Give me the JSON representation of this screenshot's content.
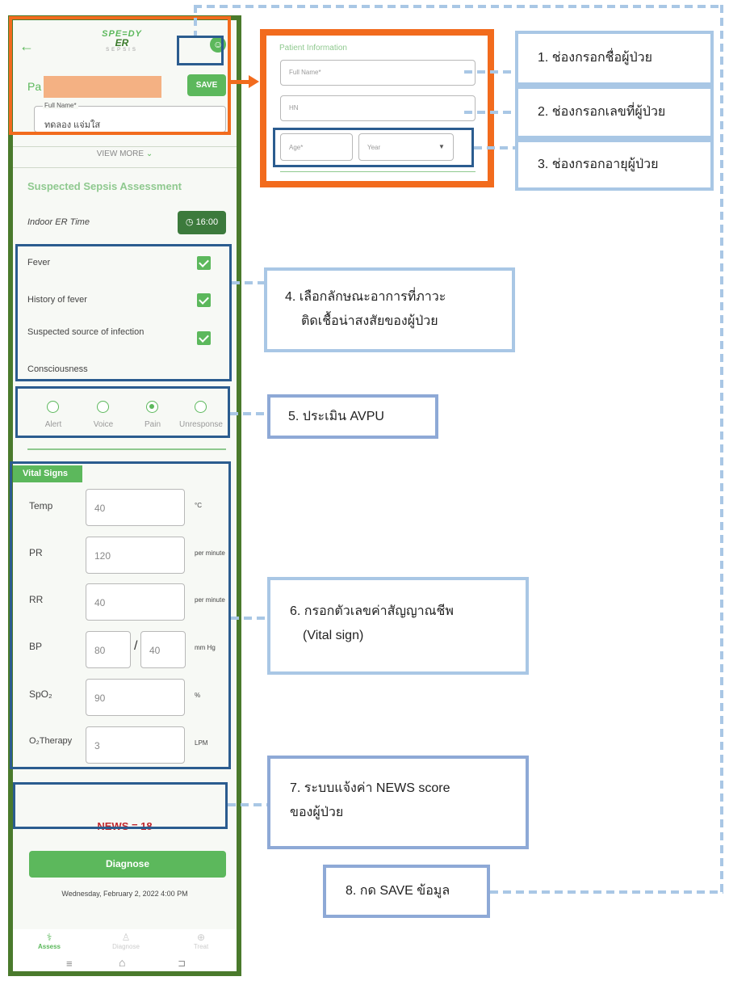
{
  "app": {
    "logo_top": "SPE=DY",
    "logo_mid": "ER",
    "logo_sub": "SEPSIS",
    "save_label": "SAVE",
    "patient_heading_partial": "Pa",
    "full_name_label": "Full Name*",
    "full_name_value": "ทดลอง แจ่มใส",
    "view_more": "VIEW MORE",
    "section_title": "Suspected Sepsis Assessment",
    "indoor_er_label": "Indoor ER Time",
    "indoor_er_time": "16:00",
    "symptoms": [
      {
        "label": "Fever",
        "checked": true
      },
      {
        "label": "History of fever",
        "checked": true
      },
      {
        "label": "Suspected source of infection",
        "checked": true
      }
    ],
    "consciousness_label": "Consciousness",
    "avpu": [
      {
        "label": "Alert",
        "selected": false
      },
      {
        "label": "Voice",
        "selected": false
      },
      {
        "label": "Pain",
        "selected": true
      },
      {
        "label": "Unresponse",
        "selected": false
      }
    ],
    "vital_title": "Vital Signs",
    "vitals": {
      "temp": {
        "label": "Temp",
        "value": "40",
        "unit": "°C"
      },
      "pr": {
        "label": "PR",
        "value": "120",
        "unit": "per minute"
      },
      "rr": {
        "label": "RR",
        "value": "40",
        "unit": "per minute"
      },
      "bp": {
        "label": "BP",
        "systolic": "80",
        "sep": "/",
        "diastolic": "40",
        "unit": "mm Hg"
      },
      "spo2": {
        "label": "SpO₂",
        "value": "90",
        "unit": "%"
      },
      "o2": {
        "label": "O₂Therapy",
        "value": "3",
        "unit": "LPM"
      }
    },
    "news_score": "NEWS = 18",
    "diagnose_label": "Diagnose",
    "datetime": "Wednesday, February 2, 2022 4:00 PM",
    "bottom_tabs": [
      {
        "label": "Assess",
        "active": true
      },
      {
        "label": "Diagnose",
        "active": false
      },
      {
        "label": "Treat",
        "active": false
      }
    ]
  },
  "zoom_panel": {
    "heading": "Patient Information",
    "full_name_placeholder": "Full Name*",
    "hn_placeholder": "HN",
    "age_placeholder": "Age*",
    "unit_select": "Year"
  },
  "callouts": {
    "c1": "1. ช่องกรอกชื่อผู้ป่วย",
    "c2": "2. ช่องกรอกเลขที่ผู้ป่วย",
    "c3": "3. ช่องกรอกอายุผู้ป่วย",
    "c4_line1": "4.  เลือกลักษณะอาการที่ภาวะ",
    "c4_line2": "ติดเชื้อน่าสงสัยของผู้ป่วย",
    "c5": "5.  ประเมิน AVPU",
    "c6_line1": "6. กรอกตัวเลขค่าสัญญาณชีพ",
    "c6_line2": "(Vital sign)",
    "c7_line1": "7. ระบบแจ้งค่า NEWS score",
    "c7_line2": "ของผู้ป่วย",
    "c8": "8. กด SAVE ข้อมูล"
  },
  "colors": {
    "frame_green": "#4a7a2c",
    "accent_green": "#5cb85c",
    "highlight_orange": "#f26b1d",
    "callout_blue": "#a9c7e5",
    "frame_blue": "#2b5c8f",
    "news_red": "#c0272d",
    "redaction": "#f4b183"
  }
}
